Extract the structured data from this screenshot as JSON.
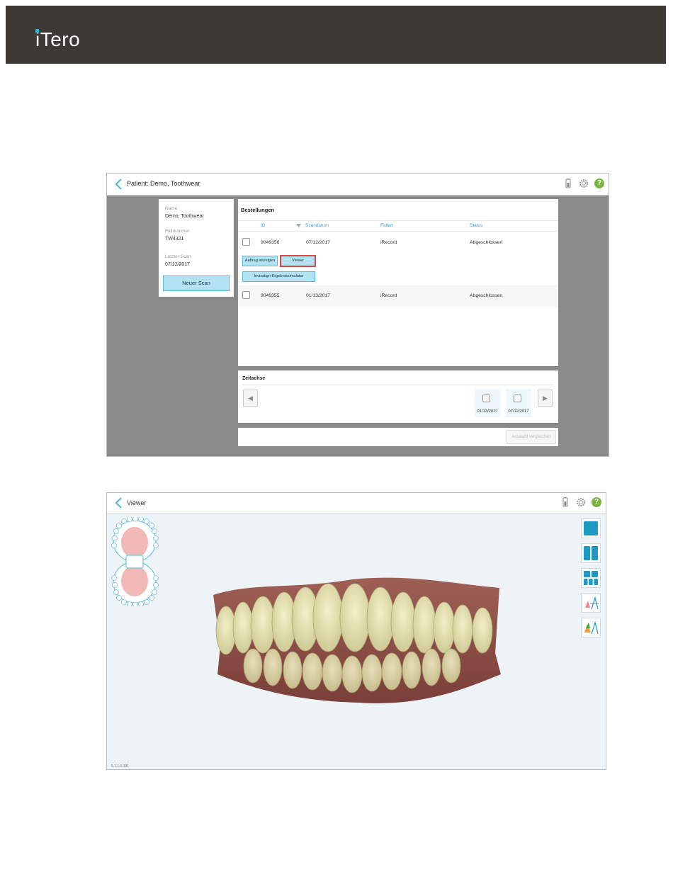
{
  "brand": {
    "logo_text": "iTero",
    "banner_color": "#3d3935",
    "accent": "#29b6d6"
  },
  "screen1": {
    "title": "Patient: Demo, Toothwear",
    "icons": [
      "battery-icon",
      "gear-icon",
      "help-icon"
    ],
    "help_glyph": "?",
    "patient": {
      "name_label": "Name",
      "name": "Demo, Toothwear",
      "case_label": "Fallnummer",
      "case": "TW4321",
      "last_scan_label": "Letzter Scan",
      "last_scan": "07/12/2017",
      "new_scan": "Neuer Scan"
    },
    "orders": {
      "title": "Bestellungen",
      "columns": [
        "ID",
        "Scandatum",
        "Fallart",
        "Status"
      ],
      "rows": [
        {
          "id": "9049356",
          "date": "07/12/2017",
          "type": "iRecord",
          "status": "Abgeschlossen"
        },
        {
          "id": "9049355",
          "date": "01/13/2017",
          "type": "iRecord",
          "status": "Abgeschlossen"
        }
      ],
      "actions": {
        "view_order": "Auftrag anzeigen",
        "viewer": "Viewer",
        "invisalign": "Invisalign-Ergebnissimulator"
      }
    },
    "timeline": {
      "title": "Zeitachse",
      "dates": [
        "01/13/2017",
        "07/12/2017"
      ],
      "prev": "◀",
      "next": "▶"
    },
    "compare": "Auswahl vergleichen"
  },
  "screen2": {
    "title": "Viewer",
    "tools": [
      "single-view-icon",
      "two-view-icon",
      "five-view-icon",
      "occlusion-tool-icon",
      "colored-occlusion-icon"
    ],
    "version": "5.1.1.0.331"
  }
}
